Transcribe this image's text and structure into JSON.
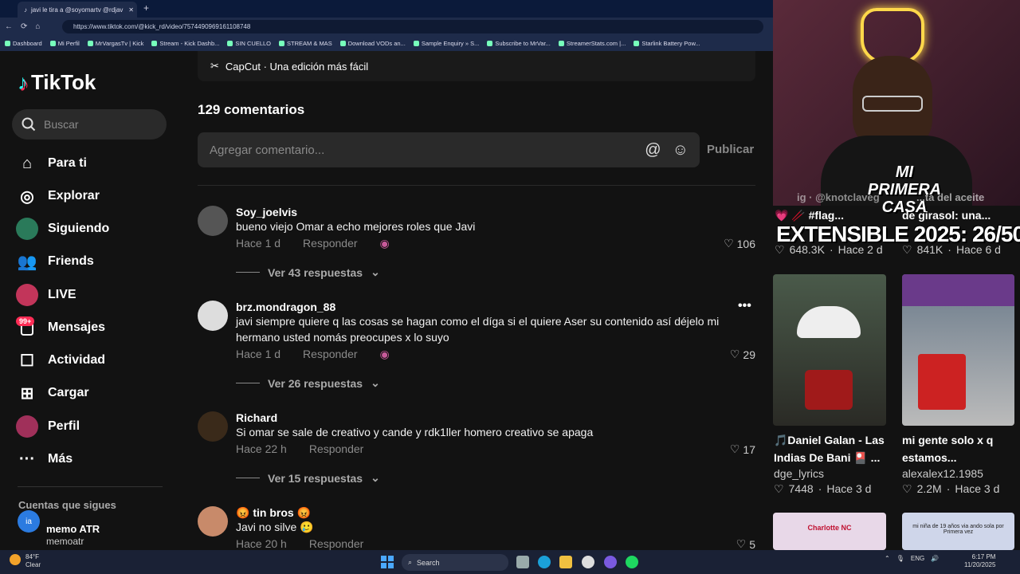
{
  "browser": {
    "tab_title": "javi le tira a @soyomartv @rdjav",
    "url": "https://www.tiktok.com/@kick_rd/video/7574490969161108748",
    "bookmarks": [
      "Dashboard",
      "Mi Perfil",
      "MrVargasTv | Kick",
      "Stream - Kick Dashb...",
      "SIN CUELLO",
      "STREAM & MAS",
      "Download VODs an...",
      "Sample Enquiry » S...",
      "Subscribe to MrVar...",
      "StreamerStats.com |...",
      "Starlink Battery Pow..."
    ]
  },
  "sidebar": {
    "logo": "TikTok",
    "search_placeholder": "Buscar",
    "items": [
      {
        "label": "Para ti",
        "icon": "home-icon"
      },
      {
        "label": "Explorar",
        "icon": "compass-icon"
      },
      {
        "label": "Siguiendo",
        "icon": "following-avatar"
      },
      {
        "label": "Friends",
        "icon": "friends-icon"
      },
      {
        "label": "LIVE",
        "icon": "live-avatar"
      },
      {
        "label": "Mensajes",
        "icon": "messages-icon"
      },
      {
        "label": "Actividad",
        "icon": "activity-icon"
      },
      {
        "label": "Cargar",
        "icon": "upload-icon"
      },
      {
        "label": "Perfil",
        "icon": "profile-avatar"
      },
      {
        "label": "Más",
        "icon": "more-icon"
      }
    ],
    "messages_badge": "99+",
    "following_title": "Cuentas que sigues",
    "following_user_name": "memo ATR",
    "following_user_handle": "memoatr"
  },
  "main": {
    "capcut_label": "CapCut · Una edición más fácil",
    "comment_count": "129 comentarios",
    "comment_placeholder": "Agregar comentario...",
    "publish_label": "Publicar",
    "reply_label": "Responder",
    "comments": [
      {
        "user": "Soy_joelvis",
        "text": "bueno viejo Omar a echo mejores roles que Javi",
        "time": "Hace 1 d",
        "likes": "106",
        "replies": "Ver 43 respuestas"
      },
      {
        "user": "brz.mondragon_88",
        "text": "javi siempre quiere q las cosas se hagan como el díga si el quiere Aser su contenido así déjelo mi hermano usted nomás preocupes x lo suyo",
        "time": "Hace 1 d",
        "likes": "29",
        "replies": "Ver 26 respuestas"
      },
      {
        "user": "Richard",
        "text": "Si omar se sale de creativo y cande y rdk1ller homero creativo se apaga",
        "time": "Hace 22 h",
        "likes": "17",
        "replies": "Ver 15 respuestas"
      },
      {
        "user": "😡 tin bros 😡",
        "text": "Javi no silve 🥲",
        "time": "Hace 20 h",
        "likes": "5"
      }
    ]
  },
  "stream_overlay": {
    "cam_sign": "MI PRIMERA CASA",
    "text": "EXTENSIBLE 2025: 26/50"
  },
  "related": {
    "top_left": {
      "title": "💗 🥢 #flag...",
      "handle_fragment": "ig · @knotclaveg",
      "likes": "648.3K",
      "age": "Hace 2 d"
    },
    "top_right": {
      "title": "de girasol: una...",
      "title_fragment": "...ta del aceite",
      "likes": "841K",
      "age": "Hace 6 d"
    },
    "videos": [
      {
        "title": "🎵Daniel Galan - Las Indias De Bani 🎴 ...",
        "author": "dge_lyrics",
        "likes": "7448",
        "age": "Hace 3 d"
      },
      {
        "title": "mi gente solo x q estamos...",
        "author": "alexalex12.1985",
        "likes": "2.2M",
        "age": "Hace 3 d"
      }
    ],
    "bottom_thumb_left": "Charlotte NC",
    "bottom_thumb_right": "mi niña de 19 años via ando sola por Primera vez"
  },
  "taskbar": {
    "temp": "84°F",
    "weather": "Clear",
    "search": "Search",
    "lang": "ENG",
    "time": "6:17 PM",
    "date": "11/20/2025"
  }
}
